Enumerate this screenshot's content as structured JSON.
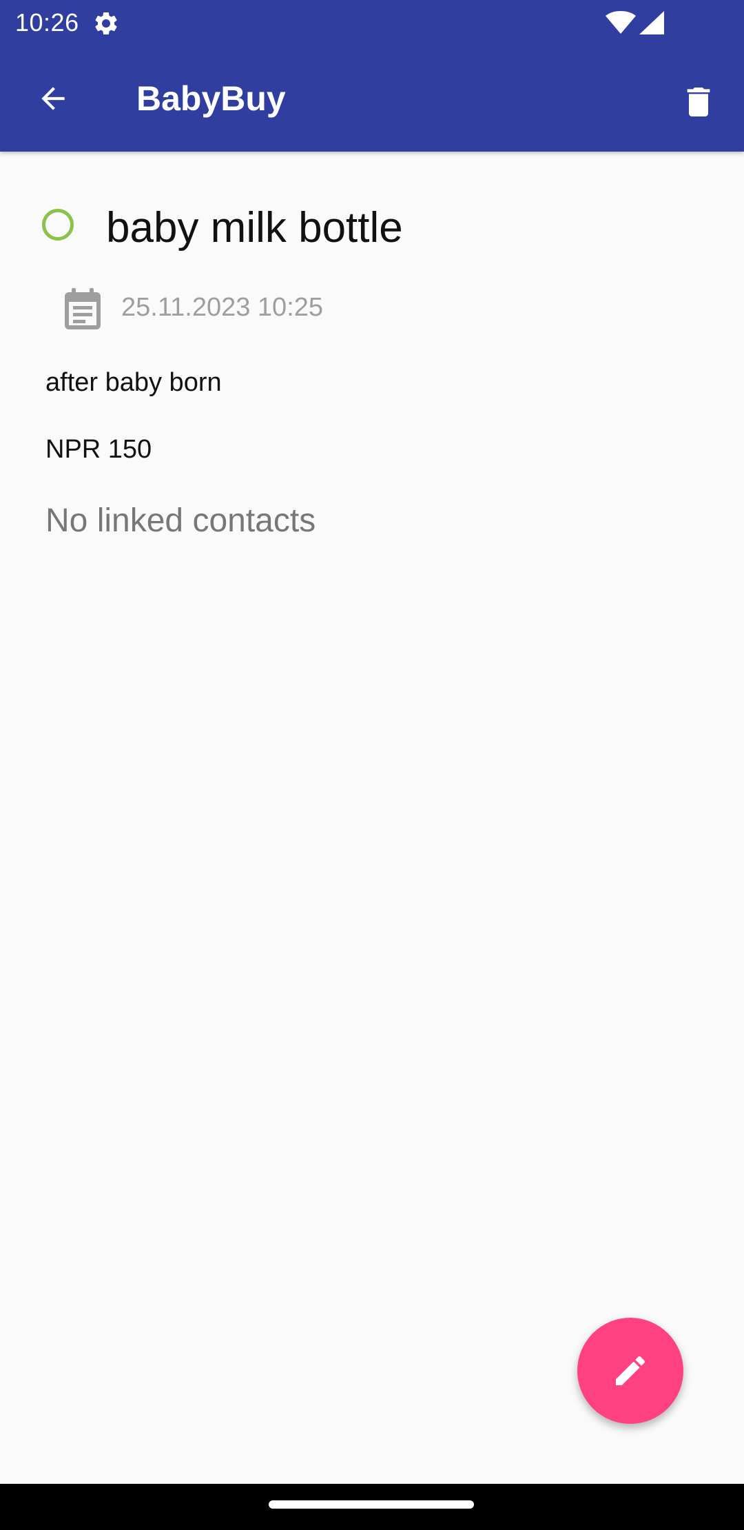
{
  "status_bar": {
    "time": "10:26",
    "icons": [
      "settings-gear-icon",
      "wifi-icon",
      "cell-signal-icon"
    ]
  },
  "toolbar": {
    "title": "BabyBuy",
    "back_icon": "arrow-back-icon",
    "delete_icon": "trash-icon",
    "background_color": "#303f9f"
  },
  "item": {
    "title": "baby milk bottle",
    "date": "25.11.2023 10:25",
    "note": "after baby born",
    "price": "NPR 150",
    "contacts_text": "No linked contacts",
    "status_color": "#8bc34a"
  },
  "fab": {
    "icon": "pencil-icon",
    "color": "#ff4081"
  }
}
